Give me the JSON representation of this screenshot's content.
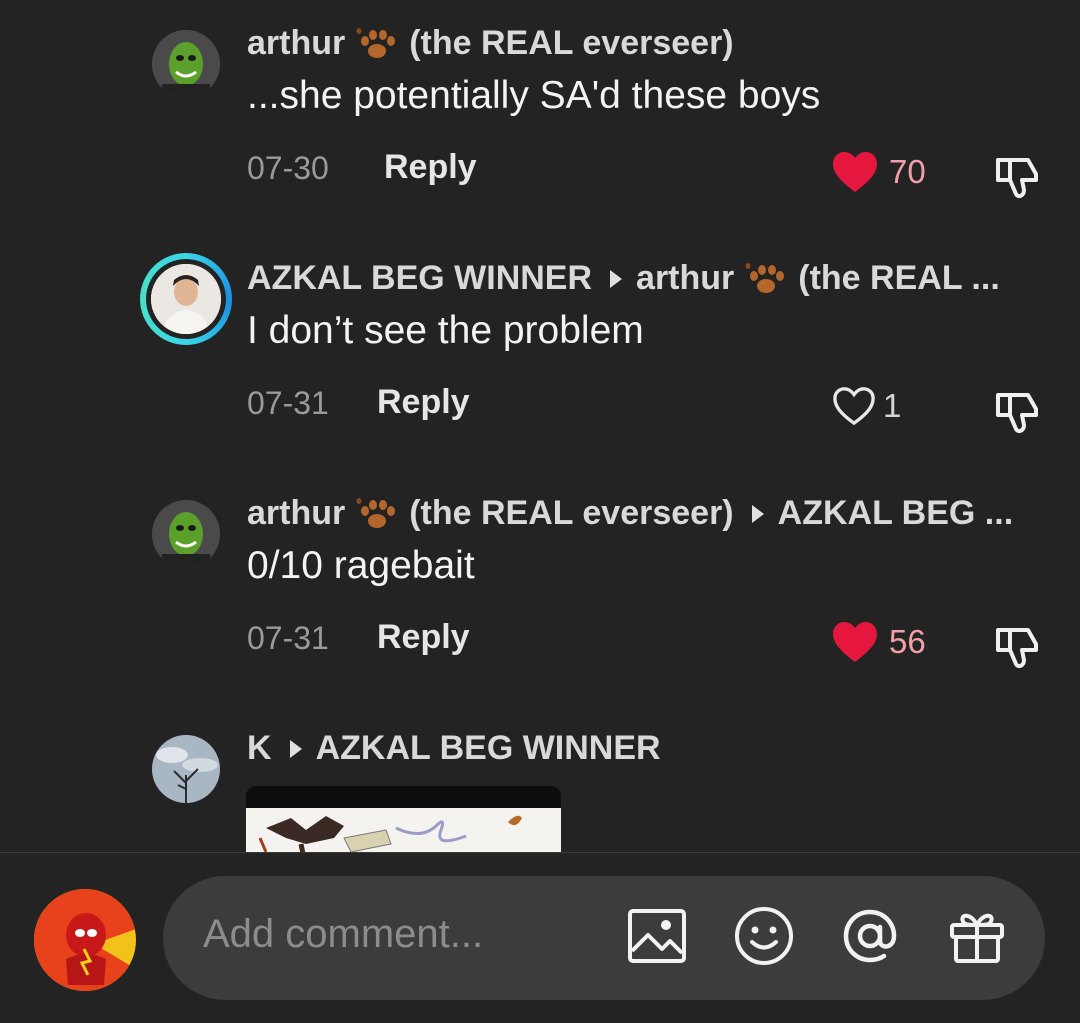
{
  "comments": [
    {
      "author": "arthur",
      "author_suffix": "(the REAL everseer)",
      "reply_to": "",
      "text": "...she potentially SA'd these boys",
      "date": "07-30",
      "reply_label": "Reply",
      "likes": "70",
      "liked": true,
      "avatar": "green-mask-avatar"
    },
    {
      "author": "AZKAL BEG WINNER",
      "author_suffix": "",
      "reply_to": "arthur",
      "reply_to_suffix": "(the REAL ...",
      "text": "I don’t see the problem",
      "date": "07-31",
      "reply_label": "Reply",
      "likes": "1",
      "liked": false,
      "avatar": "portrait-avatar-story-ring"
    },
    {
      "author": "arthur",
      "author_suffix": "(the REAL everseer)",
      "reply_to": "AZKAL BEG ...",
      "text": "0/10 ragebait",
      "date": "07-31",
      "reply_label": "Reply",
      "likes": "56",
      "liked": true,
      "avatar": "green-mask-avatar"
    },
    {
      "author": "K",
      "reply_to": "AZKAL BEG WINNER",
      "has_image_attachment": true,
      "avatar": "tree-sky-avatar"
    }
  ],
  "composer": {
    "placeholder": "Add comment...",
    "icons": [
      "image-icon",
      "emoji-icon",
      "mention-icon",
      "gift-icon"
    ]
  },
  "colors": {
    "background": "#232323",
    "like_active": "#e5173f",
    "like_count_active": "#f2a0a8",
    "input_background": "#3c3c3c"
  }
}
